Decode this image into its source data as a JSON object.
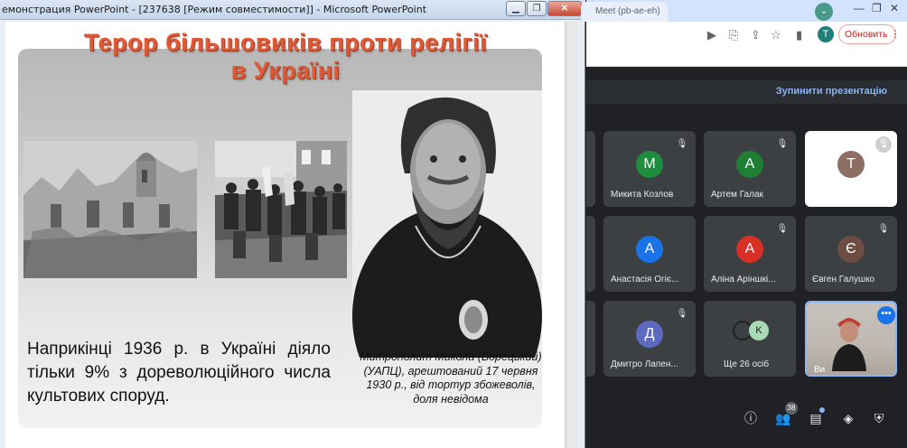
{
  "ppt": {
    "title": "емонстрация PowerPoint - [237638 [Режим совместимости]] - Microsoft PowerPoint",
    "slide": {
      "title_line1": "Терор більшовиків проти релігії",
      "title_line2": "в Україні",
      "body_text": "Наприкінці 1936 р. в Україні діяло тільки 9% з дореволюційного числа культових споруд.",
      "caption": "Митрополит Микола (Борецький) (УАПЦ), арештований 17 червня 1930 р., від тортур збожеволів, доля невідома"
    }
  },
  "chrome": {
    "tab_title": "Meet (pb-ae-eh)",
    "update_label": "Обновить",
    "profile_initial": "T"
  },
  "meet": {
    "stop_presenting": "Зупинити презентацію",
    "more_people": "Ще 26 осіб",
    "more_initial": "K",
    "participants_count": "38",
    "self_label": "Ви",
    "participants": [
      {
        "name": "Микита Козлов",
        "initial": "М",
        "color": "#1e8e3e"
      },
      {
        "name": "Артем Галак",
        "initial": "А",
        "color": "#1e7e34"
      },
      {
        "name": "",
        "initial": "T",
        "color": "#8d6e63"
      },
      {
        "name": "Анастасія Огіє...",
        "initial": "А",
        "color": "#1a73e8"
      },
      {
        "name": "Аліна Аріншкі...",
        "initial": "А",
        "color": "#d93025"
      },
      {
        "name": "Євген Галушко",
        "initial": "Є",
        "color": "#6d4c41"
      },
      {
        "name": "Дмитро Лапен...",
        "initial": "Д",
        "color": "#5c6bc0"
      }
    ]
  }
}
